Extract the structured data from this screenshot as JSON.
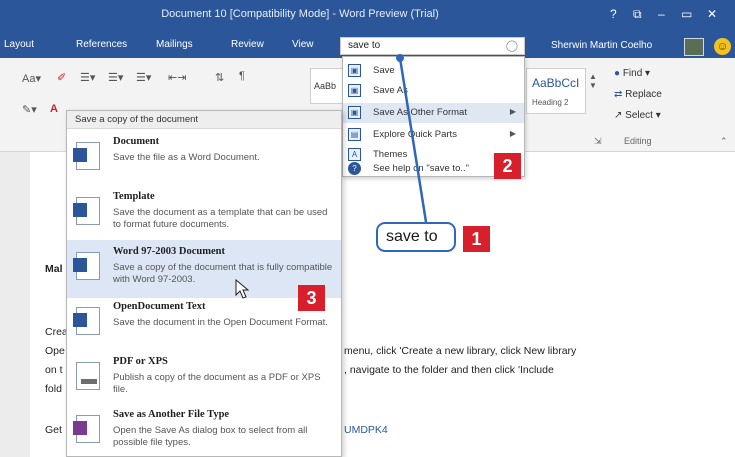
{
  "window": {
    "title": "Document 10 [Compatibility Mode] - Word Preview (Trial)",
    "controls": [
      "?",
      "⧉",
      "–",
      "▭",
      "✕"
    ]
  },
  "tabs": [
    "Layout",
    "References",
    "Mailings",
    "Review",
    "View"
  ],
  "tell_me": {
    "query": "save to"
  },
  "user": {
    "name": "Sherwin Martin Coelho"
  },
  "ribbon": {
    "style_sample": "AaBbCcI",
    "style_sample_short": "AaBb",
    "heading_style": "Heading 2",
    "find": "Find",
    "replace": "Replace",
    "select": "Select",
    "editing": "Editing"
  },
  "tell_me_menu": {
    "items": [
      {
        "label": "Save",
        "icon": "save-icon"
      },
      {
        "label": "Save As",
        "icon": "save-as-icon"
      },
      {
        "label": "Save As Other Format",
        "icon": "save-format-icon",
        "submenu": true
      },
      {
        "label": "Explore Quick Parts",
        "icon": "quick-parts-icon",
        "submenu": true
      },
      {
        "label": "Themes",
        "icon": "themes-icon"
      },
      {
        "label": "See help on \"save to..\"",
        "icon": "help-icon"
      }
    ]
  },
  "save_copy_menu": {
    "header": "Save a copy of the document",
    "items": [
      {
        "title": "Document",
        "desc": "Save the file as a Word Document."
      },
      {
        "title": "Template",
        "desc": "Save the document as a template that can be used to format future documents."
      },
      {
        "title": "Word 97-2003 Document",
        "desc": "Save a copy of the document that is fully compatible with Word 97-2003."
      },
      {
        "title": "OpenDocument Text",
        "desc": "Save the document in the Open Document Format."
      },
      {
        "title": "PDF or XPS",
        "desc": "Publish a copy of the document as a PDF or XPS file."
      },
      {
        "title": "Save as Another File Type",
        "desc": "Open the Save As dialog box to select from all possible file types."
      }
    ]
  },
  "document": {
    "lines": [
      "Mal",
      "Crea",
      "Ope",
      "menu, click 'Create a new library, click New library",
      "on t",
      ", navigate to the folder and then click 'Include",
      "fold",
      "Get",
      "UMDPK4"
    ]
  },
  "callouts": {
    "main": "save to",
    "badges": [
      "1",
      "2",
      "3"
    ]
  },
  "colors": {
    "accent": "#2b579a",
    "badge": "#d7202c",
    "callout_border": "#2f68b8"
  }
}
